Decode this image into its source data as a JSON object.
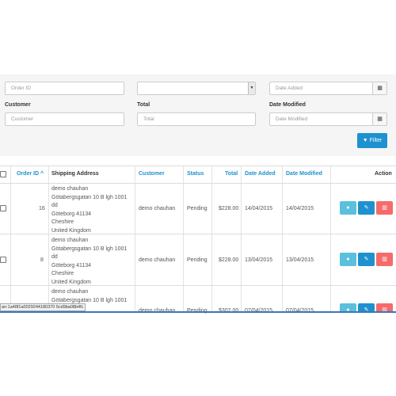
{
  "filters": {
    "order_id_placeholder": "Order ID",
    "order_status_value": "",
    "date_added_placeholder": "Date Added",
    "customer_label": "Customer",
    "customer_placeholder": "Customer",
    "total_label": "Total",
    "total_placeholder": "Total",
    "date_modified_label": "Date Modified",
    "date_modified_placeholder": "Date Modified",
    "filter_button_label": "Filter",
    "filter_icon": "filter-icon",
    "calendar_icon": "calendar-icon"
  },
  "table": {
    "headers": {
      "order_id": "Order ID",
      "shipping_address": "Shipping Address",
      "customer": "Customer",
      "status": "Status",
      "total": "Total",
      "date_added": "Date Added",
      "date_modified": "Date Modified",
      "action": "Action"
    },
    "rows": [
      {
        "order_id": "16",
        "address": [
          "demo chauhan",
          "Götabergsgatan 10 B lgh 1001",
          "dd",
          "Göteborg 41134",
          "Cheshire",
          "United Kingdom"
        ],
        "customer": "demo chauhan",
        "status": "Pending",
        "total": "$228.00",
        "date_added": "14/04/2015",
        "date_modified": "14/04/2015"
      },
      {
        "order_id": "8",
        "address": [
          "demo chauhan",
          "Götabergsgatan 10 B lgh 1001",
          "dd",
          "Göteborg 41134",
          "Cheshire",
          "United Kingdom"
        ],
        "customer": "demo chauhan",
        "status": "Pending",
        "total": "$228.00",
        "date_added": "13/04/2015",
        "date_modified": "13/04/2015"
      },
      {
        "order_id": "",
        "address": [
          "demo chauhan",
          "Götabergsgatan 10 B lgh 1001"
        ],
        "customer": "demo chauhan",
        "status": "Pending",
        "total": "$302.00",
        "date_added": "07/04/2015",
        "date_modified": "07/04/2015"
      }
    ],
    "action_icons": [
      "eye-icon",
      "pencil-icon",
      "trash-icon"
    ]
  },
  "status_bar": {
    "text": "an:1a48f1a0029244180370 5cd9ba08b4fc"
  },
  "colors": {
    "primary": "#1e91cf",
    "info": "#5bc0de",
    "danger": "#f56b6b",
    "panel": "#f5f5f5"
  }
}
